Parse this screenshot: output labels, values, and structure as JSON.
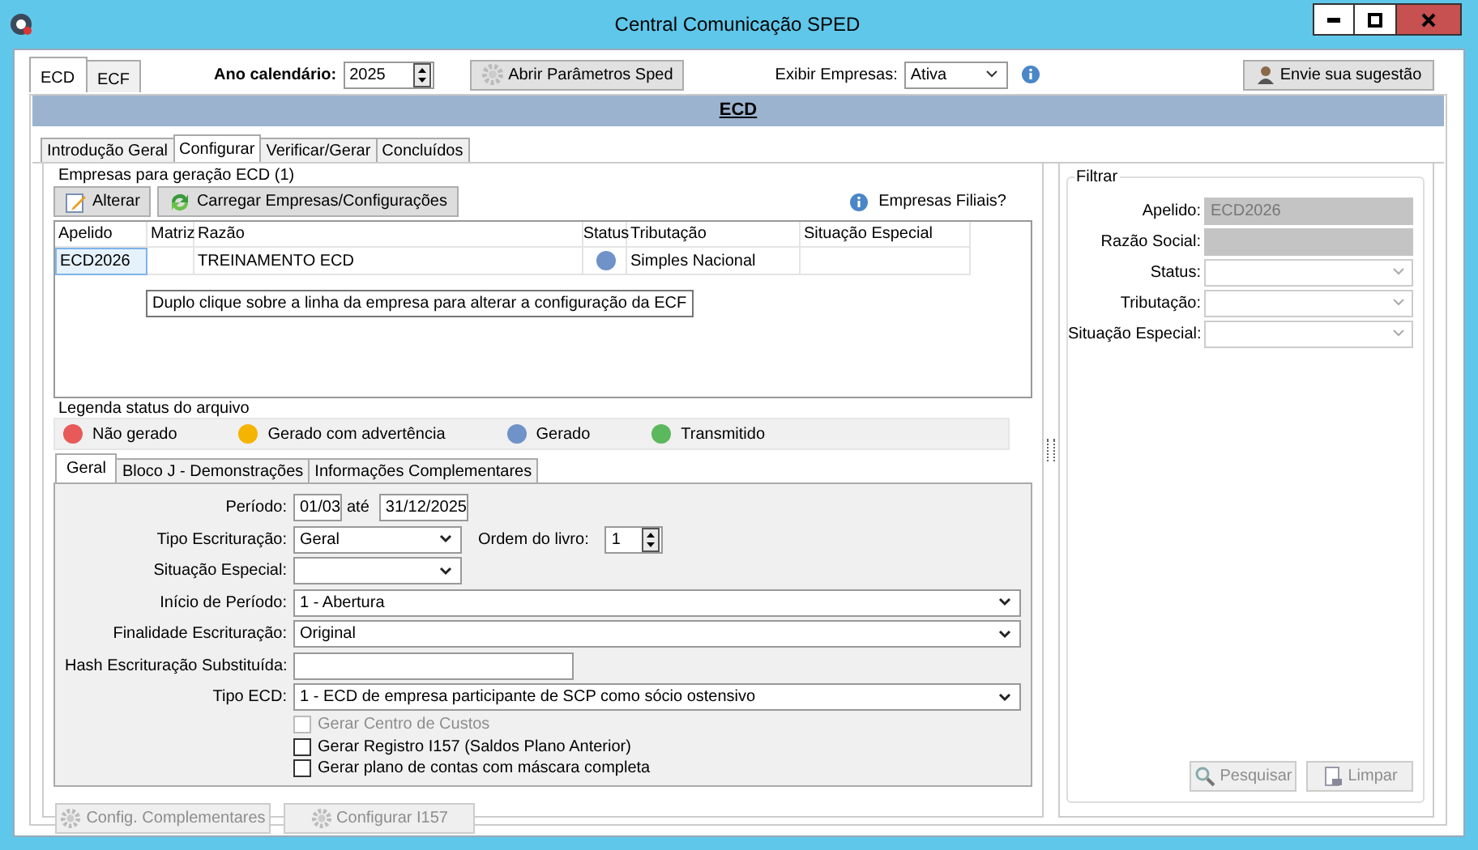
{
  "window": {
    "title": "Central Comunicação SPED"
  },
  "module_tabs": [
    {
      "label": "ECD",
      "selected": true
    },
    {
      "label": "ECF",
      "selected": false
    }
  ],
  "toolbar": {
    "year_label": "Ano calendário:",
    "year": "2025",
    "params_button": "Abrir Parâmetros Sped",
    "show_label": "Exibir Empresas:",
    "show_value": "Ativa",
    "suggest_button": "Envie sua sugestão"
  },
  "banner": "ECD",
  "tabs": [
    {
      "label": "Introdução Geral",
      "selected": false
    },
    {
      "label": "Configurar",
      "selected": true
    },
    {
      "label": "Verificar/Gerar",
      "selected": false
    },
    {
      "label": "Concluídos",
      "selected": false
    }
  ],
  "companies": {
    "title": "Empresas para geração ECD (1)",
    "buttons": [
      {
        "label": "Alterar",
        "kind": "edit"
      },
      {
        "label": "Carregar Empresas/Configurações",
        "kind": "reload"
      }
    ],
    "filiais": "Empresas Filiais?",
    "columns": [
      "Apelido",
      "Matriz",
      "Razão",
      "Status",
      "Tributação",
      "Situação Especial"
    ],
    "rows": [
      {
        "apelido": "ECD2026",
        "razao": "TREINAMENTO ECD",
        "color": "#6f93c8",
        "tributacao": "Simples Nacional",
        "selected": true
      }
    ],
    "tooltip": "Duplo clique sobre a linha da empresa para alterar a configuração da ECF"
  },
  "legend": {
    "title": "Legenda status do arquivo",
    "items": [
      {
        "label": "Não gerado",
        "color": "#e85a5a"
      },
      {
        "label": "Gerado com advertência",
        "color": "#f5b400"
      },
      {
        "label": "Gerado",
        "color": "#6f93c8"
      },
      {
        "label": "Transmitido",
        "color": "#5cb85c"
      }
    ]
  },
  "detail_tabs": [
    {
      "label": "Geral",
      "selected": true
    },
    {
      "label": "Bloco J - Demonstrações",
      "selected": false
    },
    {
      "label": "Informações Complementares",
      "selected": false
    }
  ],
  "form": {
    "period_label": "Período:",
    "period_from": "01/03",
    "period_sep": "até",
    "period_to": "31/12/2025",
    "tipo_label": "Tipo Escrituração:",
    "tipo_value": "Geral",
    "ordem_label": "Ordem do livro:",
    "ordem_value": "1",
    "fields": [
      {
        "label": "Situação Especial:",
        "kind": "short-select"
      },
      {
        "label": "Início de Período:",
        "kind": "select",
        "value": "1 - Abertura"
      },
      {
        "label": "Finalidade Escrituração:",
        "kind": "select",
        "value": "Original"
      },
      {
        "label": "Hash Escrituração Substituída:",
        "kind": "text"
      },
      {
        "label": "Tipo ECD:",
        "kind": "select",
        "value": "1 - ECD de empresa participante de SCP como sócio ostensivo"
      }
    ],
    "checkboxes": [
      {
        "label": "Gerar Centro de Custos",
        "checked": false,
        "disabled": true
      },
      {
        "label": "Gerar Registro I157 (Saldos Plano Anterior)",
        "checked": false,
        "disabled": false
      },
      {
        "label": "Gerar plano de contas com máscara completa",
        "checked": false,
        "disabled": false
      }
    ]
  },
  "bottom_buttons": [
    {
      "label": "Config. Complementares",
      "disabled": true
    },
    {
      "label": "Configurar I157",
      "disabled": true
    }
  ],
  "filter": {
    "title": "Filtrar",
    "fields": [
      {
        "label": "Apelido:",
        "kind": "text",
        "value": "ECD2026",
        "disabled": true
      },
      {
        "label": "Razão Social:",
        "kind": "text",
        "disabled": true
      },
      {
        "label": "Status:",
        "kind": "select",
        "disabled": false
      },
      {
        "label": "Tributação:",
        "kind": "select",
        "disabled": false
      },
      {
        "label": "Situação Especial:",
        "kind": "select",
        "disabled": false
      }
    ],
    "buttons": [
      {
        "label": "Pesquisar",
        "kind": "search",
        "disabled": true
      },
      {
        "label": "Limpar",
        "kind": "clear",
        "disabled": true
      }
    ]
  }
}
